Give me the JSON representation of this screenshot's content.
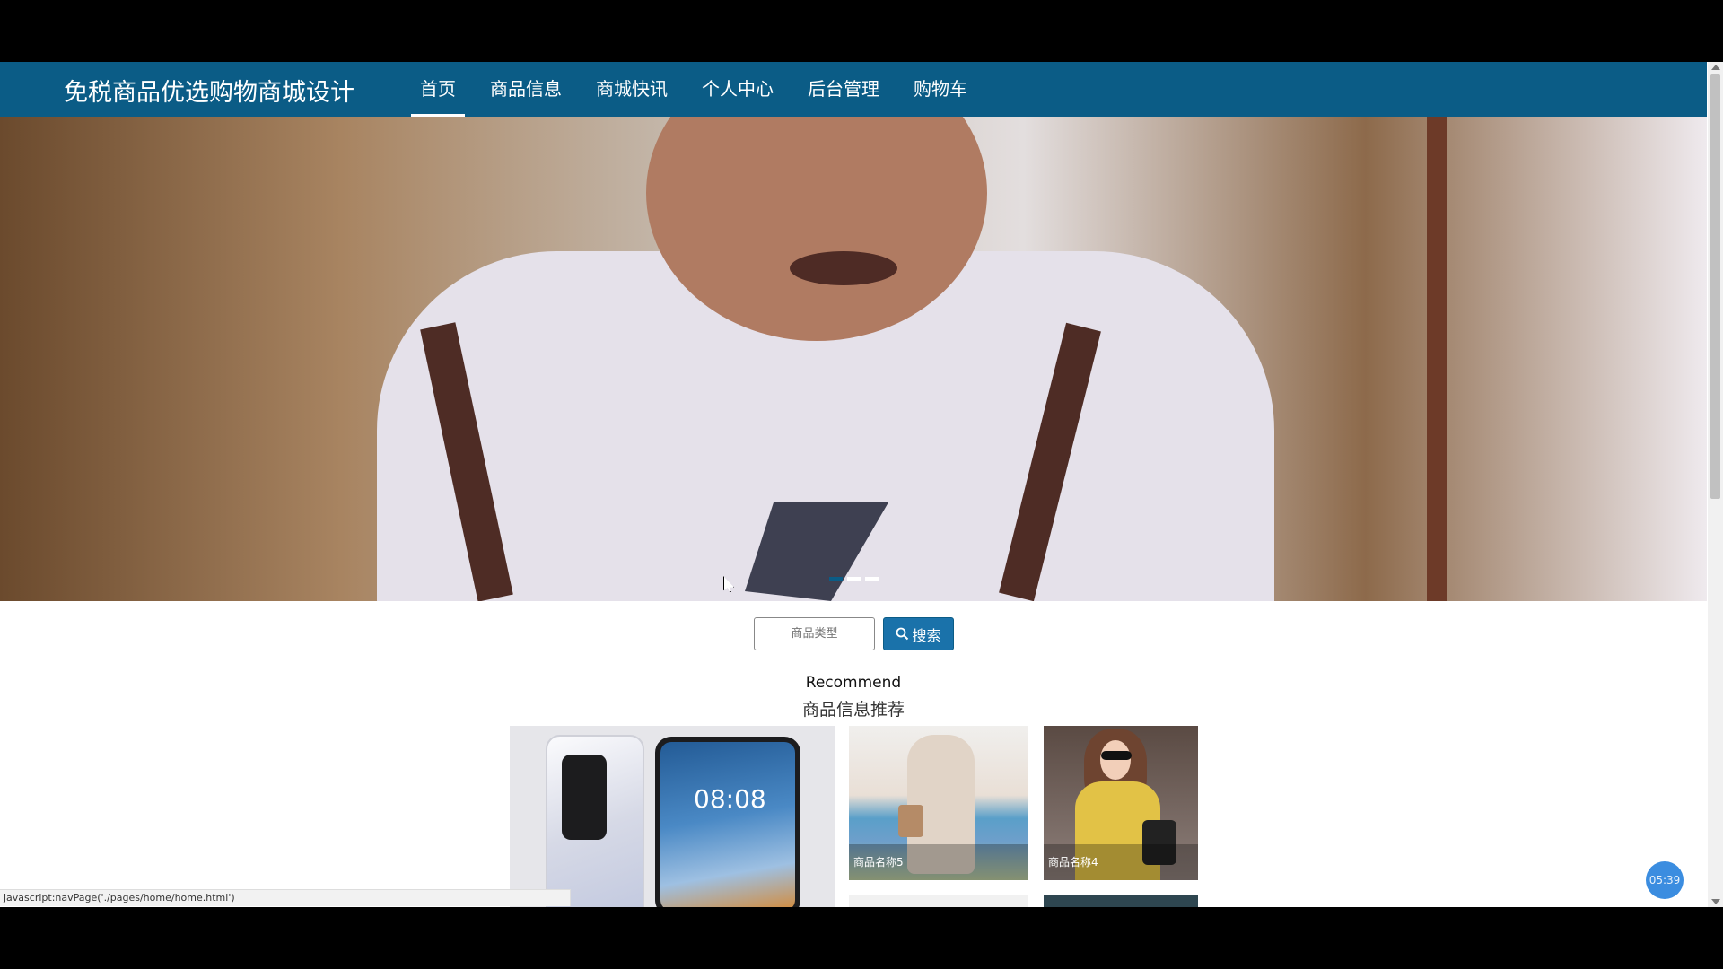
{
  "navbar": {
    "brand": "免税商品优选购物商城设计",
    "items": [
      {
        "label": "首页",
        "active": true
      },
      {
        "label": "商品信息",
        "active": false
      },
      {
        "label": "商城快讯",
        "active": false
      },
      {
        "label": "个人中心",
        "active": false
      },
      {
        "label": "后台管理",
        "active": false
      },
      {
        "label": "购物车",
        "active": false
      }
    ],
    "color": "#0b5c86"
  },
  "banner": {
    "slides_count": 3,
    "active_slide": 1
  },
  "search": {
    "placeholder": "商品类型",
    "button_label": "搜索",
    "button_icon": "search-icon"
  },
  "recommend": {
    "title_en": "Recommend",
    "title_cn": "商品信息推荐",
    "products": [
      {
        "name": "",
        "image": "phone"
      },
      {
        "name": "商品名称5",
        "image": "dress"
      },
      {
        "name": "商品名称4",
        "image": "yellow-sweater"
      }
    ],
    "phone_clock": "08:08"
  },
  "statusbar": {
    "text": "javascript:navPage('./pages/home/home.html')"
  },
  "timer": {
    "text": "05:39"
  }
}
